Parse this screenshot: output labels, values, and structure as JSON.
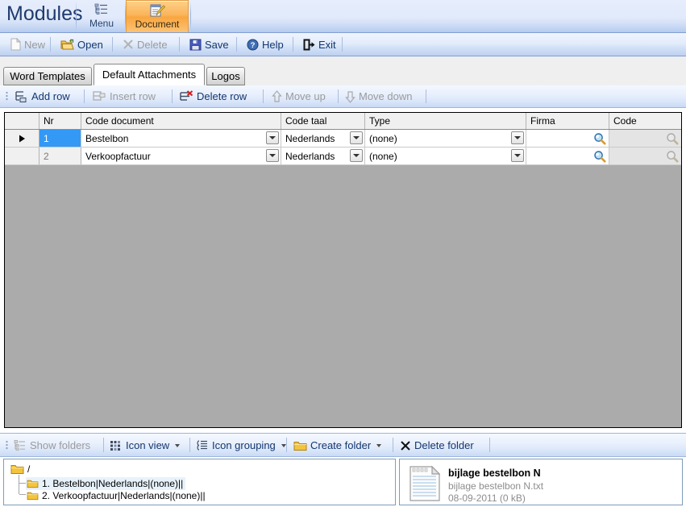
{
  "ribbon": {
    "title": "Modules",
    "buttons": [
      {
        "label": "Menu",
        "icon": "list-menu-icon",
        "active": false
      },
      {
        "label": "Document",
        "icon": "document-edit-icon",
        "active": true
      }
    ]
  },
  "toolbar": {
    "items": [
      {
        "label": "New",
        "icon": "new-page-icon",
        "enabled": false
      },
      {
        "label": "Open",
        "icon": "open-folder-icon",
        "enabled": true
      },
      {
        "label": "Delete",
        "icon": "delete-x-icon",
        "enabled": false
      },
      {
        "label": "Save",
        "icon": "save-disk-icon",
        "enabled": true
      },
      {
        "label": "Help",
        "icon": "help-circle-icon",
        "enabled": true
      },
      {
        "label": "Exit",
        "icon": "exit-door-icon",
        "enabled": true
      }
    ]
  },
  "tabs": [
    {
      "label": "Word Templates",
      "selected": false
    },
    {
      "label": "Default Attachments",
      "selected": true
    },
    {
      "label": "Logos",
      "selected": false
    }
  ],
  "rowbar": {
    "items": [
      {
        "label": "Add row",
        "icon": "add-row-icon",
        "enabled": true
      },
      {
        "label": "Insert row",
        "icon": "insert-row-icon",
        "enabled": false
      },
      {
        "label": "Delete row",
        "icon": "delete-row-icon",
        "enabled": true
      },
      {
        "label": "Move up",
        "icon": "arrow-up-icon",
        "enabled": false
      },
      {
        "label": "Move down",
        "icon": "arrow-down-icon",
        "enabled": false
      }
    ]
  },
  "grid": {
    "columns": [
      {
        "label": "",
        "key": "selector"
      },
      {
        "label": "Nr",
        "key": "nr"
      },
      {
        "label": "Code document",
        "key": "code_document"
      },
      {
        "label": "Code taal",
        "key": "code_taal"
      },
      {
        "label": "Type",
        "key": "type"
      },
      {
        "label": "Firma",
        "key": "firma"
      },
      {
        "label": "Code",
        "key": "code"
      }
    ],
    "rows": [
      {
        "current": true,
        "nr": "1",
        "code_document": "Bestelbon",
        "code_taal": "Nederlands",
        "type": "(none)",
        "firma": "",
        "code": ""
      },
      {
        "current": false,
        "nr": "2",
        "code_document": "Verkoopfactuur",
        "code_taal": "Nederlands",
        "type": "(none)",
        "firma": "",
        "code": ""
      }
    ]
  },
  "folderbar": {
    "items": [
      {
        "label": "Show folders",
        "icon": "show-folders-icon",
        "enabled": false,
        "dropdown": false
      },
      {
        "label": "Icon view",
        "icon": "icon-view-icon",
        "enabled": true,
        "dropdown": true
      },
      {
        "label": "Icon grouping",
        "icon": "icon-grouping-icon",
        "enabled": true,
        "dropdown": true
      },
      {
        "label": "Create folder",
        "icon": "folder-icon",
        "enabled": true,
        "dropdown": true
      },
      {
        "label": "Delete folder",
        "icon": "delete-x-icon",
        "enabled": true,
        "dropdown": false
      }
    ]
  },
  "tree": {
    "root": {
      "label": "/",
      "icon": "folder-open-icon"
    },
    "children": [
      {
        "label": "1. Bestelbon|Nederlands|(none)||",
        "icon": "folder-icon",
        "highlighted": true
      },
      {
        "label": "2. Verkoopfactuur|Nederlands|(none)||",
        "icon": "folder-icon",
        "highlighted": false
      }
    ]
  },
  "detail": {
    "icon": "text-file-icon",
    "title": "bijlage bestelbon N",
    "filename": "bijlage bestelbon N.txt",
    "meta": "08-09-2011 (0 kB)"
  },
  "colors": {
    "accent_blue": "#3399f5",
    "ribbon_active": "#f9a63f",
    "grid_empty": "#ababab",
    "text_blue": "#14366e"
  }
}
